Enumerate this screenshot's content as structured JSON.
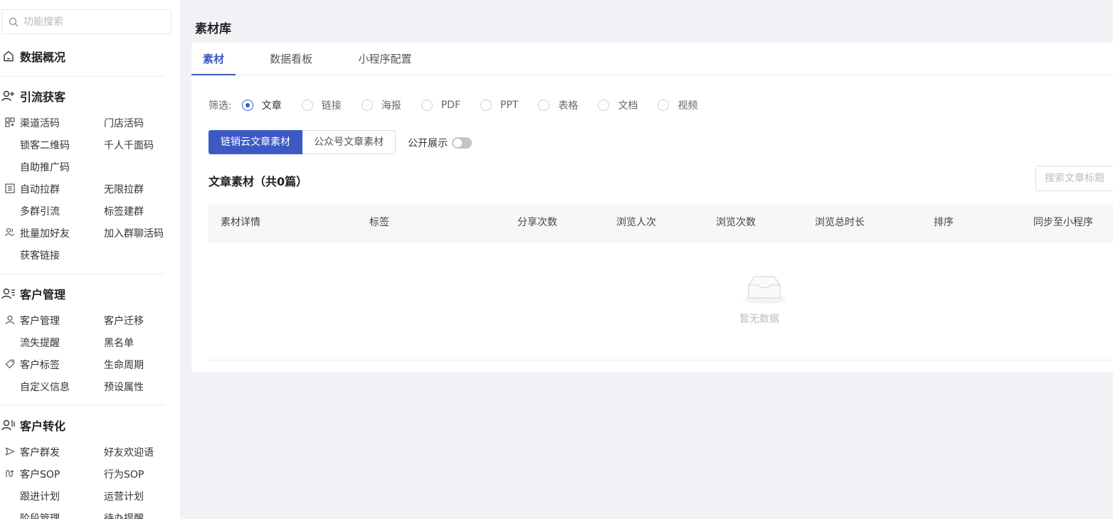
{
  "sidebar": {
    "search_placeholder": "功能搜索",
    "sections": [
      {
        "title": "数据概况"
      },
      {
        "title": "引流获客"
      },
      {
        "title": "客户管理"
      },
      {
        "title": "客户转化"
      }
    ],
    "items": {
      "qudao": "渠道活码",
      "mendian": "门店活码",
      "suoke": "锁客二维码",
      "qianren": "千人千面码",
      "zizhu": "自助推广码",
      "zidong": "自动拉群",
      "wuxian": "无限拉群",
      "duoqun": "多群引流",
      "biaoqianjianqun": "标签建群",
      "piliang": "批量加好友",
      "jiaru": "加入群聊活码",
      "huoke": "获客链接",
      "kehuguanli": "客户管理",
      "qianyi": "客户迁移",
      "liushi": "流失提醒",
      "heimingdan": "黑名单",
      "kehubiaoqian": "客户标签",
      "shengming": "生命周期",
      "zidingyi": "自定义信息",
      "yushe": "预设属性",
      "qunfa": "客户群发",
      "huanying": "好友欢迎语",
      "kehusop": "客户SOP",
      "xingweisop": "行为SOP",
      "genjin": "跟进计划",
      "yunying": "运营计划",
      "jieduan": "阶段管理",
      "daiban": "待办提醒"
    }
  },
  "page": {
    "title": "素材库",
    "tabs": [
      "素材",
      "数据看板",
      "小程序配置"
    ],
    "filter_label": "筛选:",
    "filter_options": [
      "文章",
      "链接",
      "海报",
      "PDF",
      "PPT",
      "表格",
      "文档",
      "视频"
    ],
    "buttons": {
      "primary": "链销云文章素材",
      "secondary": "公众号文章素材"
    },
    "toggle_label": "公开展示",
    "list_title": "文章素材（共0篇）",
    "search_placeholder": "搜索文章标题",
    "columns": [
      "素材详情",
      "标签",
      "分享次数",
      "浏览人次",
      "浏览次数",
      "浏览总时长",
      "排序",
      "同步至小程序"
    ],
    "empty_text": "暂无数据"
  }
}
